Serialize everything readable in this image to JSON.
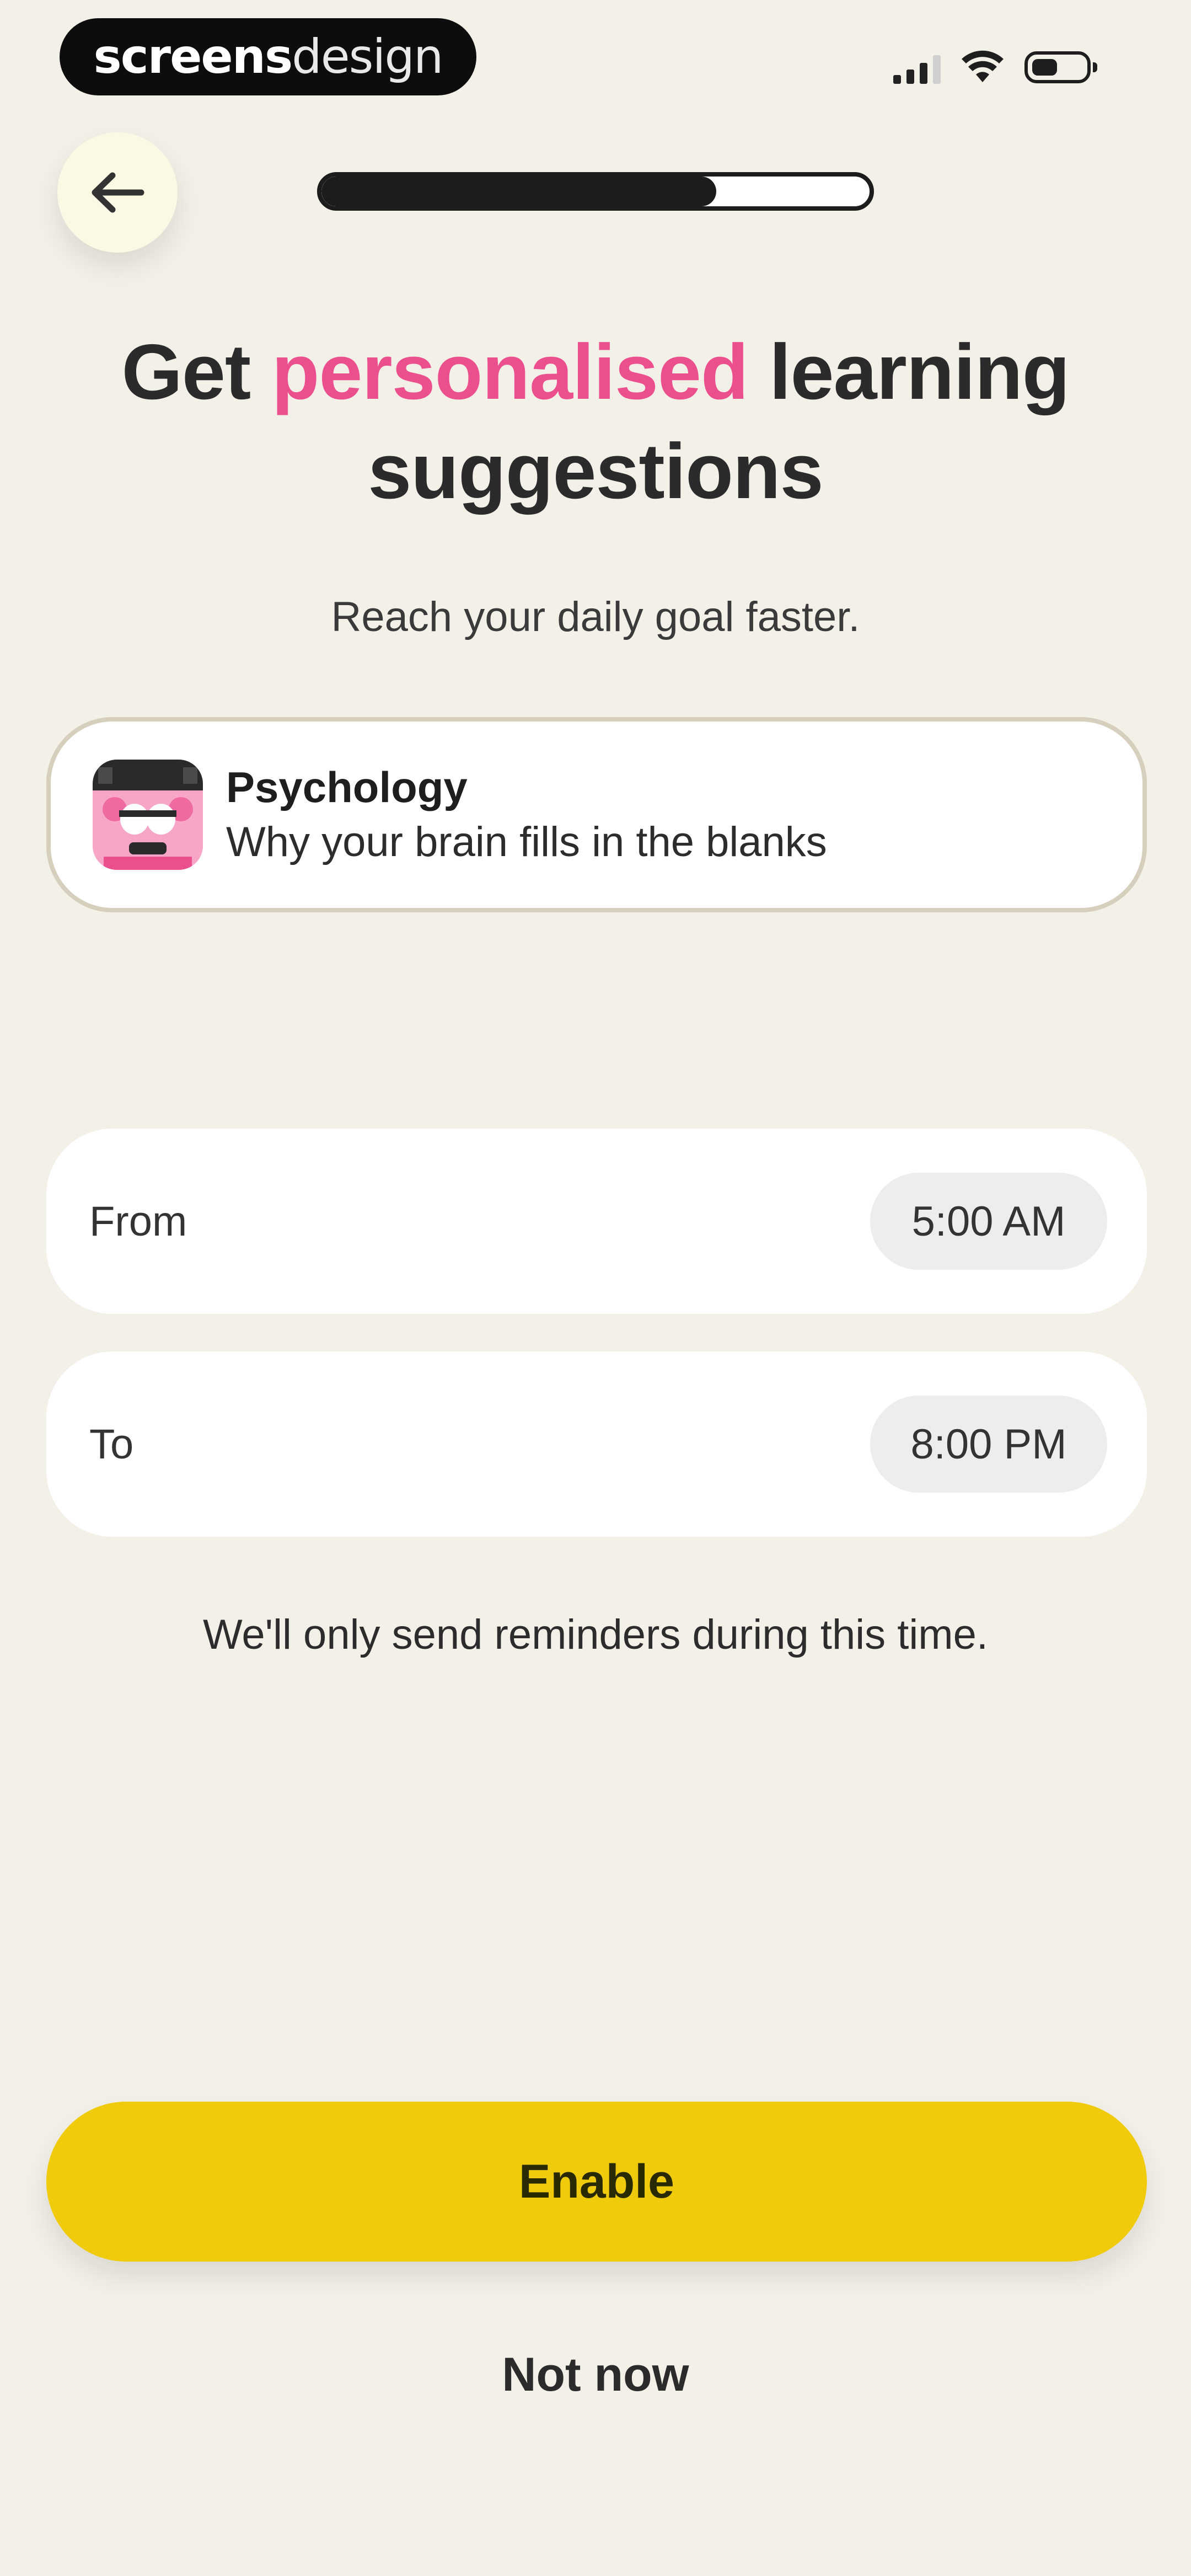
{
  "status_bar": {
    "brand_bold": "screens",
    "brand_light": "design",
    "icons": [
      "signal-icon",
      "wifi-icon",
      "battery-icon"
    ]
  },
  "header": {
    "back_icon": "arrow-left-icon",
    "progress_fraction": 0.72
  },
  "headline": {
    "part1": "Get ",
    "accent": "personalised",
    "part2": " learning suggestions"
  },
  "subtitle": "Reach your daily goal faster.",
  "topic": {
    "title": "Psychology",
    "subtitle": "Why your brain fills in the blanks",
    "icon": "brain-character-icon"
  },
  "time_window": {
    "from_label": "From",
    "from_value": "5:00 AM",
    "to_label": "To",
    "to_value": "8:00 PM"
  },
  "note": "We'll only send reminders during this time.",
  "actions": {
    "enable_label": "Enable",
    "not_now_label": "Not now"
  },
  "colors": {
    "background": "#f3f0e8",
    "accent_pink": "#ec4f8e",
    "button_yellow": "#f0cb0c"
  }
}
